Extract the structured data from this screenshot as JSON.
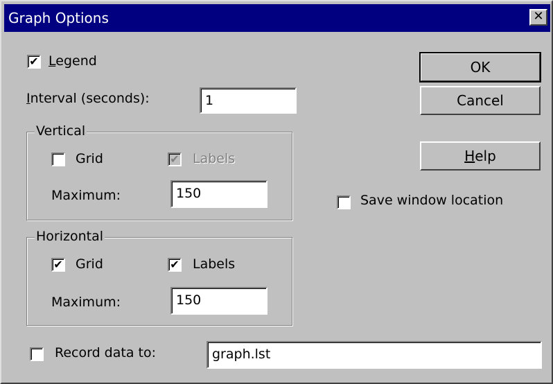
{
  "window": {
    "title": "Graph Options",
    "close_glyph": "✕"
  },
  "legend_option": {
    "label_mnemonic": "L",
    "label_rest": "egend",
    "checked": true
  },
  "interval": {
    "label_mnemonic": "I",
    "label_rest": "nterval (seconds):",
    "value": "1"
  },
  "vertical": {
    "group_label": "Vertical",
    "grid": {
      "label": "Grid",
      "checked": false
    },
    "labels": {
      "label": "Labels",
      "checked": true,
      "disabled": true
    },
    "maximum_label": "Maximum:",
    "maximum_value": "150"
  },
  "horizontal": {
    "group_label": "Horizontal",
    "grid": {
      "label": "Grid",
      "checked": true
    },
    "labels": {
      "label": "Labels",
      "checked": true
    },
    "maximum_label": "Maximum:",
    "maximum_value": "150"
  },
  "record": {
    "label": "Record data to:",
    "checked": false,
    "value": "graph.lst"
  },
  "buttons": {
    "ok": "OK",
    "cancel": "Cancel",
    "help_mnemonic": "H",
    "help_rest": "elp"
  },
  "save_location": {
    "label": "Save window location",
    "checked": false
  },
  "check_glyph": "✔"
}
